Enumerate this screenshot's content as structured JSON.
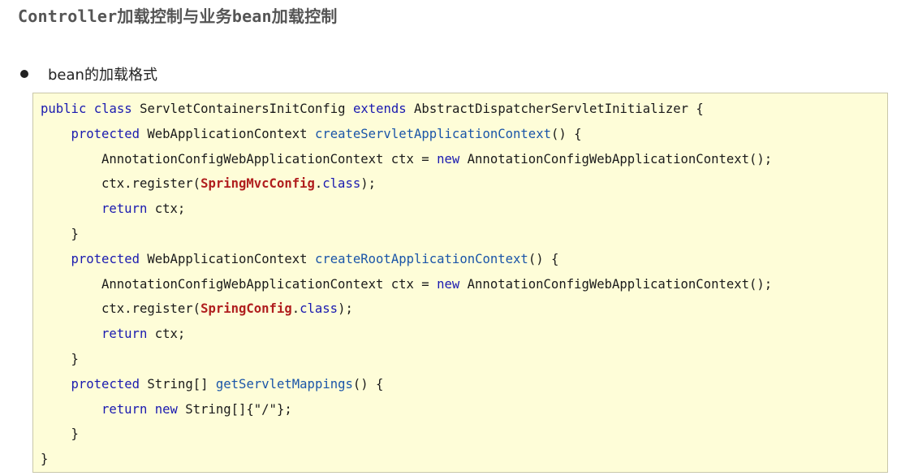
{
  "heading": {
    "part1": "Controller",
    "part2": "加载控制与业务",
    "part3": "bean",
    "part4": "加载控制"
  },
  "bullet": {
    "text": "bean的加载格式"
  },
  "code": {
    "lines": [
      {
        "indent": 0,
        "tokens": [
          {
            "t": "public ",
            "c": "kw"
          },
          {
            "t": "class ",
            "c": "kw"
          },
          {
            "t": "ServletContainersInitConfig "
          },
          {
            "t": "extends ",
            "c": "kw"
          },
          {
            "t": "AbstractDispatcherServletInitializer {"
          }
        ]
      },
      {
        "indent": 1,
        "tokens": [
          {
            "t": "protected ",
            "c": "kw"
          },
          {
            "t": "WebApplicationContext "
          },
          {
            "t": "createServletApplicationContext",
            "c": "fn"
          },
          {
            "t": "() {"
          }
        ]
      },
      {
        "indent": 2,
        "tokens": [
          {
            "t": "AnnotationConfigWebApplicationContext ctx = "
          },
          {
            "t": "new ",
            "c": "kw"
          },
          {
            "t": "AnnotationConfigWebApplicationContext();"
          }
        ]
      },
      {
        "indent": 2,
        "tokens": [
          {
            "t": "ctx.register("
          },
          {
            "t": "SpringMvcConfig",
            "c": "cls"
          },
          {
            "t": "."
          },
          {
            "t": "class",
            "c": "kw"
          },
          {
            "t": ");"
          }
        ]
      },
      {
        "indent": 2,
        "tokens": [
          {
            "t": "return ",
            "c": "kw"
          },
          {
            "t": "ctx;"
          }
        ]
      },
      {
        "indent": 1,
        "tokens": [
          {
            "t": "}"
          }
        ]
      },
      {
        "indent": 1,
        "tokens": [
          {
            "t": "protected ",
            "c": "kw"
          },
          {
            "t": "WebApplicationContext "
          },
          {
            "t": "createRootApplicationContext",
            "c": "fn"
          },
          {
            "t": "() {"
          }
        ]
      },
      {
        "indent": 2,
        "tokens": [
          {
            "t": "AnnotationConfigWebApplicationContext ctx = "
          },
          {
            "t": "new ",
            "c": "kw"
          },
          {
            "t": "AnnotationConfigWebApplicationContext();"
          }
        ]
      },
      {
        "indent": 2,
        "tokens": [
          {
            "t": "ctx.register("
          },
          {
            "t": "SpringConfig",
            "c": "cls"
          },
          {
            "t": "."
          },
          {
            "t": "class",
            "c": "kw"
          },
          {
            "t": ");"
          }
        ]
      },
      {
        "indent": 2,
        "tokens": [
          {
            "t": "return ",
            "c": "kw"
          },
          {
            "t": "ctx;"
          }
        ]
      },
      {
        "indent": 1,
        "tokens": [
          {
            "t": "}"
          }
        ]
      },
      {
        "indent": 1,
        "tokens": [
          {
            "t": "protected ",
            "c": "kw"
          },
          {
            "t": "String[] "
          },
          {
            "t": "getServletMappings",
            "c": "fn"
          },
          {
            "t": "() {"
          }
        ]
      },
      {
        "indent": 2,
        "tokens": [
          {
            "t": "return ",
            "c": "kw"
          },
          {
            "t": "new ",
            "c": "kw"
          },
          {
            "t": "String[]{\"/\"};"
          }
        ]
      },
      {
        "indent": 1,
        "tokens": [
          {
            "t": "}"
          }
        ]
      },
      {
        "indent": 0,
        "tokens": [
          {
            "t": "}"
          }
        ]
      }
    ]
  }
}
